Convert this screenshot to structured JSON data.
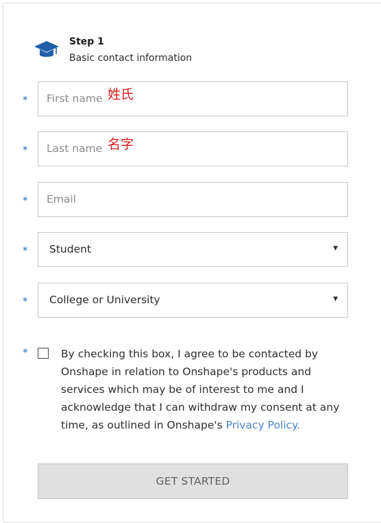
{
  "step": {
    "title": "Step 1",
    "subtitle": "Basic contact information",
    "icon": "graduation-cap-icon",
    "icon_color": "#1f5fa8"
  },
  "required_marker": "*",
  "fields": {
    "first_name": {
      "placeholder": "First name",
      "annotation": "姓氏"
    },
    "last_name": {
      "placeholder": "Last name",
      "annotation": "名字"
    },
    "email": {
      "placeholder": "Email"
    }
  },
  "selects": {
    "role": {
      "value": "Student",
      "caret": "▼"
    },
    "institution": {
      "value": "College or University",
      "caret": "▼"
    }
  },
  "consent": {
    "checked": false,
    "text": "By checking this box, I agree to be contacted by Onshape in relation to Onshape's products and services which may be of interest to me and I acknowledge that I can withdraw my consent at any time, as outlined in Onshape's ",
    "link_text": "Privacy Policy",
    "trailing": "."
  },
  "submit": {
    "label": "GET STARTED"
  },
  "colors": {
    "accent_link": "#4a84c6",
    "required": "#2f6db5",
    "annotation": "#d61c1c",
    "button_bg": "#e0e0e0"
  }
}
